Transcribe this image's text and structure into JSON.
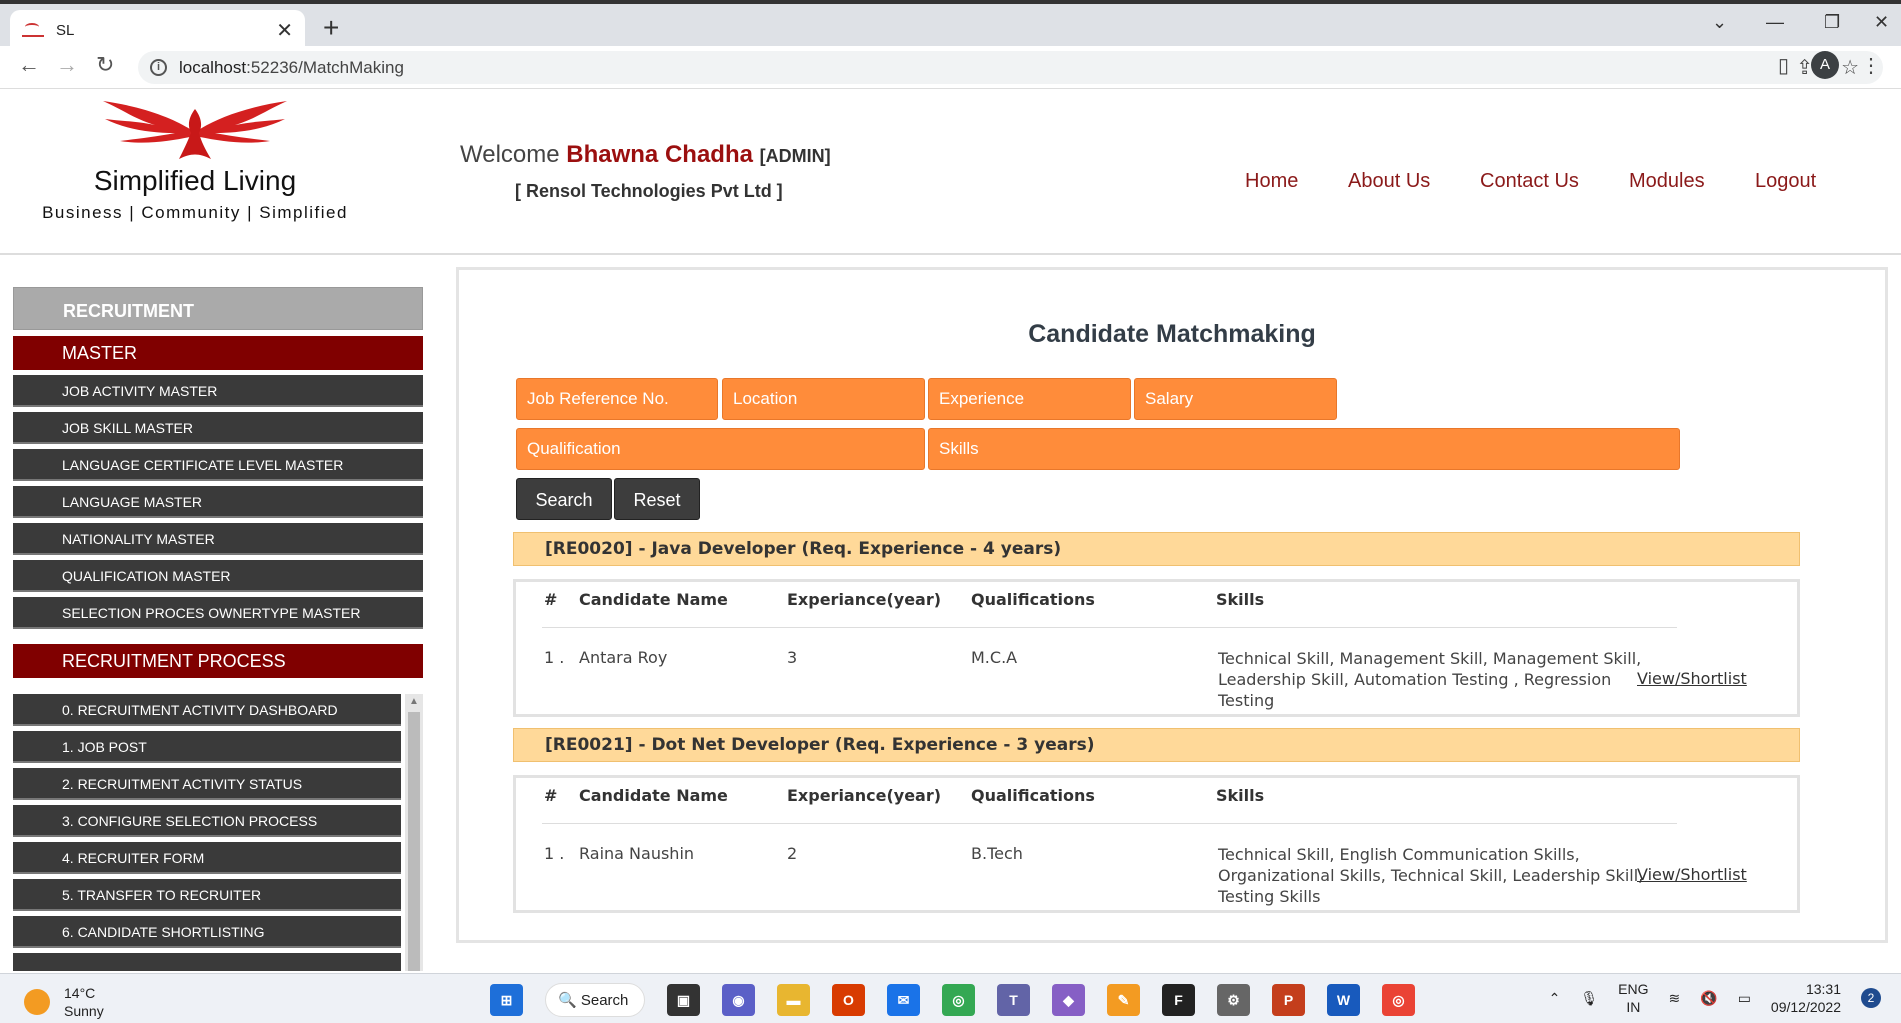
{
  "browser": {
    "tab_title": "SL",
    "tab_close": "✕",
    "new_tab": "+",
    "url_host": "localhost",
    "url_rest": ":52236/MatchMaking",
    "profile_initial": "A"
  },
  "header": {
    "brand": "Simplified Living",
    "tagline": "Business | Community | Simplified",
    "welcome": "Welcome",
    "user_name": "Bhawna Chadha",
    "role": "[ADMIN]",
    "company": "[ Rensol Technologies Pvt Ltd ]",
    "nav": [
      "Home",
      "About Us",
      "Contact Us",
      "Modules",
      "Logout"
    ]
  },
  "sidebar": {
    "heading": "RECRUITMENT",
    "master": "MASTER",
    "master_items": [
      "JOB ACTIVITY MASTER",
      "JOB SKILL MASTER",
      "LANGUAGE CERTIFICATE LEVEL MASTER",
      "LANGUAGE MASTER",
      "NATIONALITY MASTER",
      "QUALIFICATION MASTER",
      "SELECTION PROCES OWNERTYPE MASTER"
    ],
    "process": "RECRUITMENT PROCESS",
    "process_items": [
      "0. RECRUITMENT ACTIVITY DASHBOARD",
      "1. JOB POST",
      "2. RECRUITMENT ACTIVITY STATUS",
      "3. CONFIGURE SELECTION PROCESS",
      "4. RECRUITER FORM",
      "5. TRANSFER TO RECRUITER",
      "6. CANDIDATE SHORTLISTING"
    ]
  },
  "main": {
    "title": "Candidate Matchmaking",
    "filters": {
      "job_ref": "Job Reference No.",
      "location": "Location",
      "experience": "Experience",
      "salary": "Salary",
      "qualification": "Qualification",
      "skills": "Skills"
    },
    "search_label": "Search",
    "reset_label": "Reset",
    "columns": [
      "#",
      "Candidate Name",
      "Experiance(year)",
      "Qualifications",
      "Skills"
    ],
    "jobs": [
      {
        "heading": "[RE0020] - Java Developer (Req. Experience - 4 years)",
        "row": {
          "index": "1 .",
          "name": "Antara Roy",
          "experience": "3",
          "qualification": "M.C.A",
          "skills": "Technical Skill, Management Skill, Management Skill, Leadership Skill, Automation Testing , Regression Testing",
          "action": "View/Shortlist"
        }
      },
      {
        "heading": "[RE0021] - Dot Net Developer (Req. Experience - 3 years)",
        "row": {
          "index": "1 .",
          "name": "Raina Naushin",
          "experience": "2",
          "qualification": "B.Tech",
          "skills": "Technical Skill, English Communication Skills, Organizational Skills, Technical Skill, Leadership Skill, Testing Skills",
          "action": "View/Shortlist"
        }
      }
    ]
  },
  "taskbar": {
    "temp": "14°C",
    "weather": "Sunny",
    "search": "Search",
    "lang_top": "ENG",
    "lang_bottom": "IN",
    "time": "13:31",
    "date": "09/12/2022",
    "notifications": "2"
  },
  "colors": {
    "accent_red": "#800000",
    "filter_orange": "#ff8c3a",
    "job_header": "#ffd999"
  }
}
